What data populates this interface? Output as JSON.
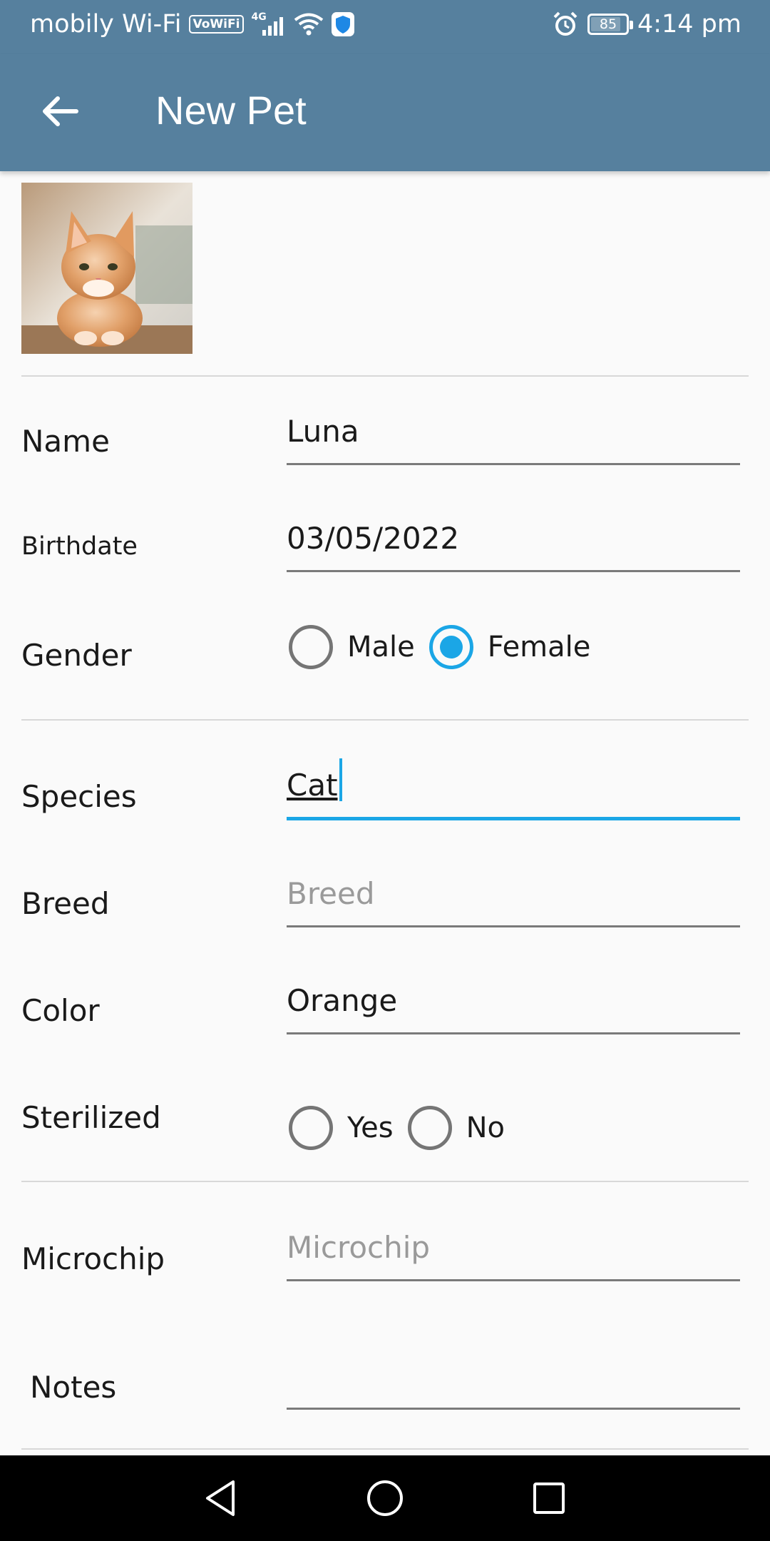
{
  "status_bar": {
    "carrier": "mobily Wi-Fi",
    "vowifi": "VoWiFi",
    "network": "4G",
    "battery": "85",
    "time": "4:14 pm"
  },
  "app_bar": {
    "title": "New Pet",
    "back_icon": "arrow-back-icon"
  },
  "photo": {
    "description_icon": "pet-photo"
  },
  "form": {
    "name": {
      "label": "Name",
      "value": "Luna"
    },
    "birthdate": {
      "label": "Birthdate",
      "value": "03/05/2022"
    },
    "gender": {
      "label": "Gender",
      "options": [
        "Male",
        "Female"
      ],
      "selected": "Female"
    },
    "species": {
      "label": "Species",
      "value": "Cat"
    },
    "breed": {
      "label": "Breed",
      "value": "",
      "placeholder": "Breed"
    },
    "color": {
      "label": "Color",
      "value": "Orange"
    },
    "sterilized": {
      "label": "Sterilized",
      "options": [
        "Yes",
        "No"
      ],
      "selected": ""
    },
    "microchip": {
      "label": "Microchip",
      "value": "",
      "placeholder": "Microchip"
    },
    "notes": {
      "label": "Notes",
      "value": ""
    }
  },
  "colors": {
    "primary": "#56809e",
    "accent": "#1ba6e6",
    "background": "#fafafa"
  }
}
